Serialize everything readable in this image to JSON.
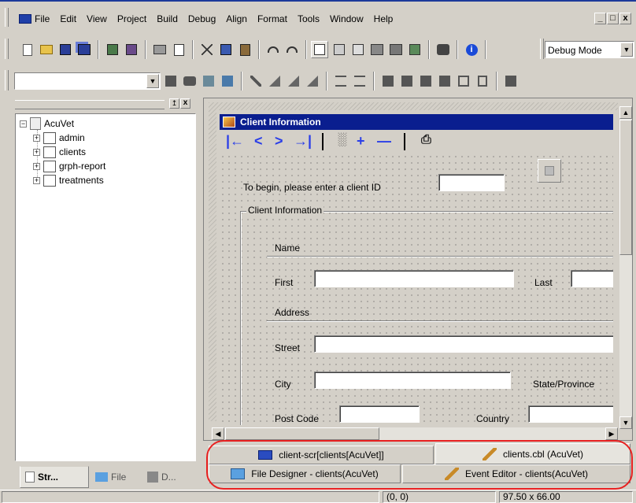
{
  "menu": {
    "items": [
      "File",
      "Edit",
      "View",
      "Project",
      "Build",
      "Debug",
      "Align",
      "Format",
      "Tools",
      "Window",
      "Help"
    ],
    "mdi_buttons": [
      "_",
      "&#9633;",
      "x"
    ]
  },
  "toolbar": {
    "mode_select": "Debug Mode",
    "combo_value": ""
  },
  "tree": {
    "root": "AcuVet",
    "children": [
      "admin",
      "clients",
      "grph-report",
      "treatments"
    ]
  },
  "left_tabs": [
    "Str...",
    "File",
    "D..."
  ],
  "form": {
    "title": "Client Information",
    "prompt": "To begin, please enter a client ID",
    "client_id_value": "",
    "group_title": "Client Information",
    "name_section": "Name",
    "first_label": "First",
    "last_label": "Last",
    "address_section": "Address",
    "street_label": "Street",
    "city_label": "City",
    "state_label": "State/Province",
    "postcode_label": "Post Code",
    "country_label": "Country"
  },
  "doc_tabs": [
    {
      "label": "client-scr[clients[AcuVet]]"
    },
    {
      "label": "clients.cbl (AcuVet)"
    },
    {
      "label": "File Designer - clients(AcuVet)"
    },
    {
      "label": "Event Editor - clients(AcuVet)"
    }
  ],
  "status": {
    "coords": "(0, 0)",
    "size": "97.50 x 66.00"
  },
  "colors": {
    "title_bar": "#0a1e8f",
    "highlight": "#e82020",
    "nav_blue": "#2a3ee8"
  }
}
